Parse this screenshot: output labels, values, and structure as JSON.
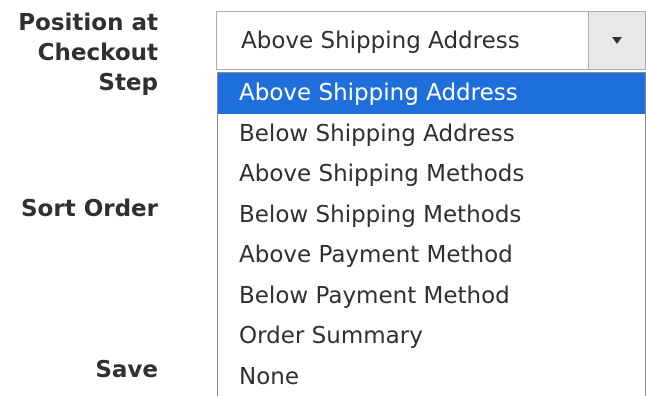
{
  "form": {
    "position_label": "Position at Checkout Step",
    "sort_order_label": "Sort Order",
    "save_label": "Save"
  },
  "select": {
    "selected_value": "Above Shipping Address",
    "chevron_icon": "chevron-down-icon"
  },
  "dropdown": {
    "options": [
      "Above Shipping Address",
      "Below Shipping Address",
      "Above Shipping Methods",
      "Below Shipping Methods",
      "Above Payment Method",
      "Below Payment Method",
      "Order Summary",
      "None"
    ]
  },
  "colors": {
    "highlight": "#1e6fdc",
    "text": "#303030",
    "button_bg": "#e8e8e8"
  }
}
